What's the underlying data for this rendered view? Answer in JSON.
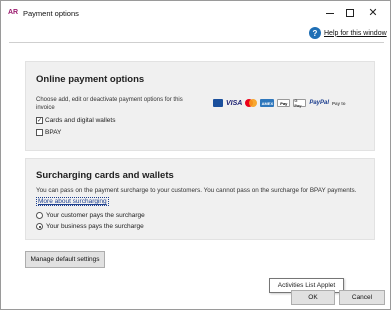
{
  "window": {
    "title": "Payment options",
    "app_icon": "AR",
    "help_label": "Help for this window",
    "help_icon": "?"
  },
  "online": {
    "title": "Online payment options",
    "description": "Choose add, edit or deactivate payment options for this invoice",
    "logos": {
      "visa": "VISA",
      "amex": "AMEX",
      "apple": "Pay",
      "gpay": "G Pay",
      "paypal": "PayPal",
      "payto": "Pay to"
    },
    "options": [
      {
        "label": "Cards and digital wallets",
        "checked": true
      },
      {
        "label": "BPAY",
        "checked": false
      }
    ]
  },
  "surcharge": {
    "title": "Surcharging cards and wallets",
    "description": "You can pass on the payment surcharge to your customers. You cannot pass on the surcharge for BPAY payments.",
    "more_link": "More about surcharging",
    "options": [
      {
        "label": "Your customer pays the surcharge",
        "selected": false
      },
      {
        "label": "Your business pays the surcharge",
        "selected": true
      }
    ]
  },
  "buttons": {
    "manage": "Manage default settings",
    "ok": "OK",
    "cancel": "Cancel"
  },
  "tooltip": "Activities List Applet",
  "colors": {
    "app_accent": "#9b1b6e",
    "help_blue": "#1f6fb5",
    "panel_bg": "#f0f0f0",
    "link": "#1d3f8f"
  }
}
